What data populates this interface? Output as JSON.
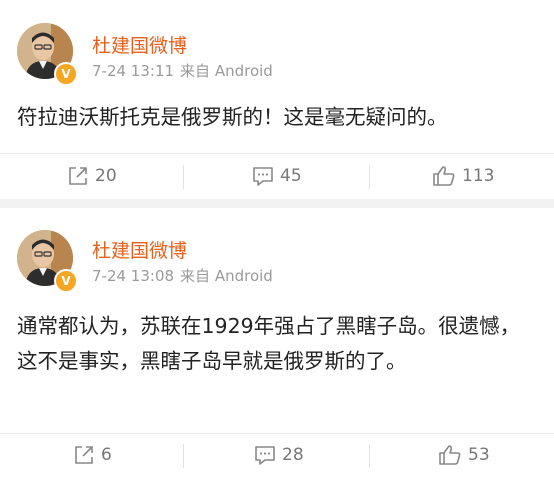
{
  "posts": [
    {
      "author": "杜建国微博",
      "time": "7-24 13:11",
      "source": "来自 Android",
      "text": "符拉迪沃斯托克是俄罗斯的！这是毫无疑问的。",
      "reposts": "20",
      "comments": "45",
      "likes": "113"
    },
    {
      "author": "杜建国微博",
      "time": "7-24 13:08",
      "source": "来自 Android",
      "text": "通常都认为，苏联在1929年强占了黑瞎子岛。很遗憾，这不是事实，黑瞎子岛早就是俄罗斯的了。",
      "reposts": "6",
      "comments": "28",
      "likes": "53"
    }
  ],
  "icons": {
    "repost": "share-icon",
    "comment": "comment-icon",
    "like": "thumbs-up-icon",
    "verified": "verified-badge-icon"
  },
  "colors": {
    "author": "#e8611c",
    "meta": "#9a9a9a",
    "text": "#222222",
    "badge": "#f5a623",
    "background": "#f2f2f2"
  }
}
